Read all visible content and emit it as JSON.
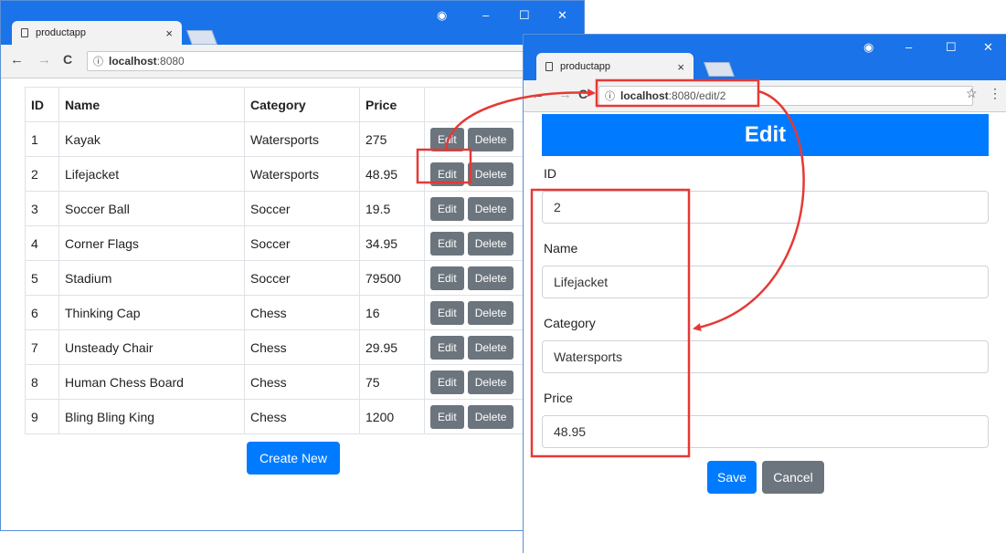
{
  "window1": {
    "tab_title": "productapp",
    "url_host": "localhost",
    "url_rest": ":8080",
    "columns": [
      "ID",
      "Name",
      "Category",
      "Price"
    ],
    "rows": [
      {
        "id": "1",
        "name": "Kayak",
        "category": "Watersports",
        "price": "275"
      },
      {
        "id": "2",
        "name": "Lifejacket",
        "category": "Watersports",
        "price": "48.95"
      },
      {
        "id": "3",
        "name": "Soccer Ball",
        "category": "Soccer",
        "price": "19.5"
      },
      {
        "id": "4",
        "name": "Corner Flags",
        "category": "Soccer",
        "price": "34.95"
      },
      {
        "id": "5",
        "name": "Stadium",
        "category": "Soccer",
        "price": "79500"
      },
      {
        "id": "6",
        "name": "Thinking Cap",
        "category": "Chess",
        "price": "16"
      },
      {
        "id": "7",
        "name": "Unsteady Chair",
        "category": "Chess",
        "price": "29.95"
      },
      {
        "id": "8",
        "name": "Human Chess Board",
        "category": "Chess",
        "price": "75"
      },
      {
        "id": "9",
        "name": "Bling Bling King",
        "category": "Chess",
        "price": "1200"
      }
    ],
    "edit_label": "Edit",
    "delete_label": "Delete",
    "create_label": "Create New"
  },
  "window2": {
    "tab_title": "productapp",
    "url_host": "localhost",
    "url_rest": ":8080/edit/2",
    "heading": "Edit",
    "id_label": "ID",
    "id_value": "2",
    "name_label": "Name",
    "name_value": "Lifejacket",
    "category_label": "Category",
    "category_value": "Watersports",
    "price_label": "Price",
    "price_value": "48.95",
    "save_label": "Save",
    "cancel_label": "Cancel"
  },
  "glyphs": {
    "tab_close": "×",
    "back": "←",
    "forward": "→",
    "reload": "C",
    "info": "ⓘ",
    "account": "◉",
    "minimize": "–",
    "maximize": "☐",
    "close": "✕",
    "star": "☆",
    "menu": "⋮"
  },
  "colors": {
    "titlebar": "#1a73e8",
    "primary": "#007bff",
    "secondary": "#6c757d",
    "highlight": "#e53935"
  }
}
